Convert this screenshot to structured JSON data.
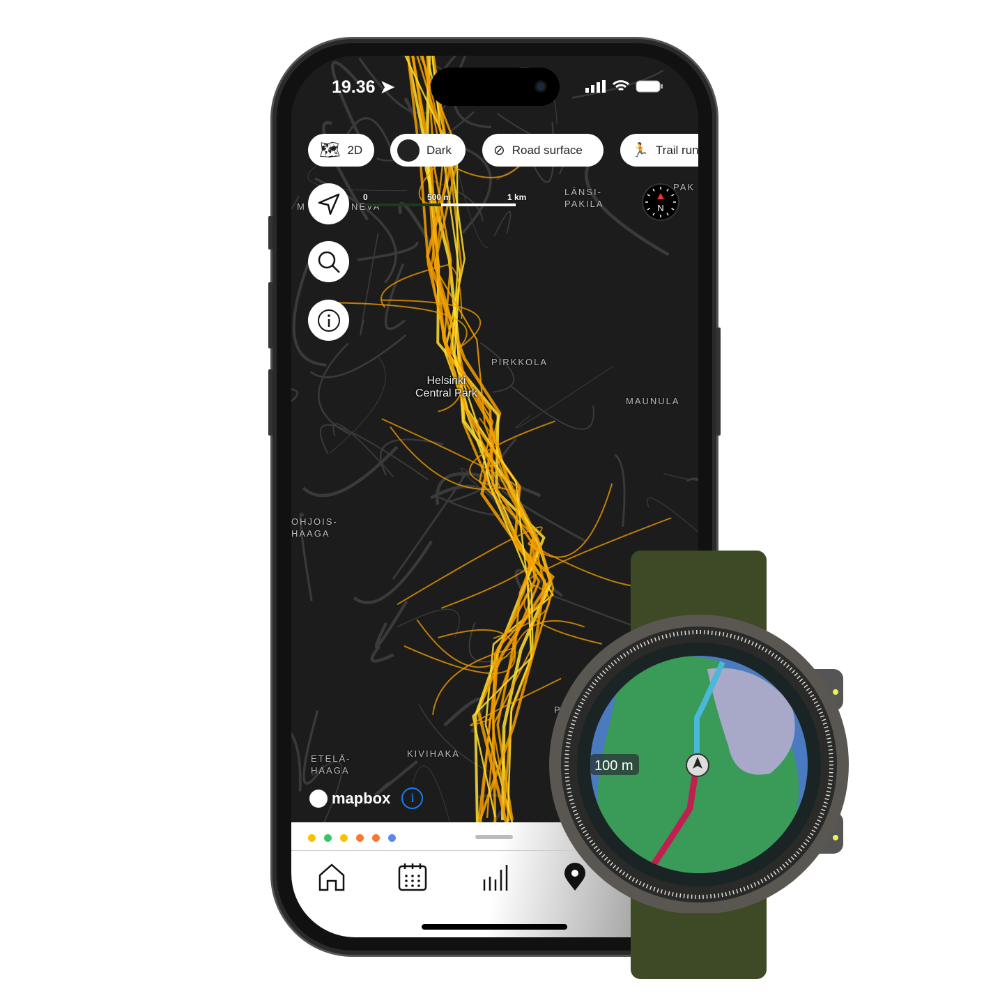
{
  "status_bar": {
    "time": "19.36"
  },
  "map_controls": {
    "chips": [
      {
        "label": "2D",
        "icon": "map-icon"
      },
      {
        "label": "Dark",
        "icon": "dark-style-thumbnail"
      },
      {
        "label": "Road surface",
        "icon": "eye-off-icon"
      },
      {
        "label": "Trail run",
        "icon": "runner-icon"
      }
    ]
  },
  "scale": {
    "zero": "0",
    "mid": "500 m",
    "end": "1 km"
  },
  "map_labels": {
    "m": "M",
    "neva": "NEVA",
    "lansi_pakila": "LÄNSI-\nPAKILA",
    "pak": "PAK",
    "pirkkola": "PIRKKOLA",
    "maunula": "MAUNULA",
    "pohjois_haaga": "OHJOIS-\nHAAGA",
    "etela_haaga": "ETELÄ-\nHAAGA",
    "kivihaka": "KIVIHAKA",
    "park": "Helsinki\nCentral Park",
    "p": "P"
  },
  "compass": {
    "north": "N"
  },
  "attribution": {
    "brand": "mapbox"
  },
  "sheet": {
    "dots": [
      "#f5c400",
      "#3cc46a",
      "#f5c400",
      "#f57a30",
      "#f57a30",
      "#5b86f0"
    ]
  },
  "tab_bar": {
    "items": [
      "home",
      "calendar",
      "stats",
      "map"
    ],
    "active": "map"
  },
  "watch": {
    "scale_label": "100 m"
  },
  "colors": {
    "heat_trail": "#f5a000",
    "heat_bright": "#ffe030",
    "map_bg": "#1c1c1c"
  }
}
